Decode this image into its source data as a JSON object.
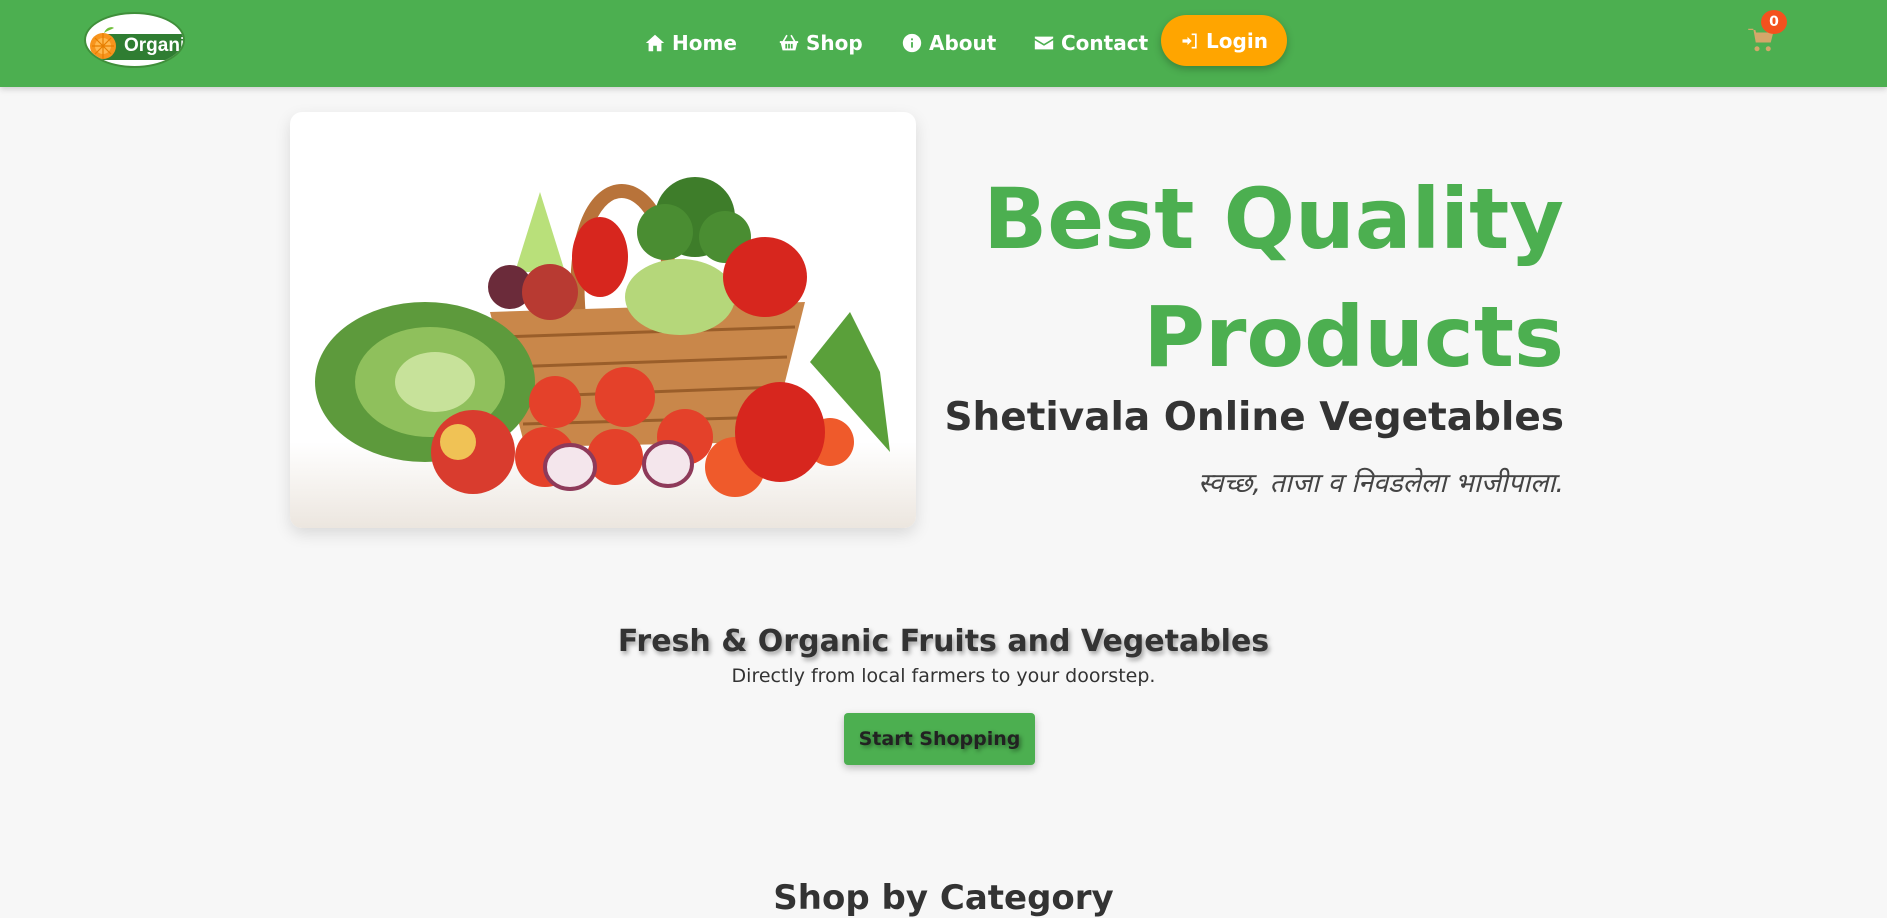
{
  "brand": {
    "logo_text": "Organi"
  },
  "nav": {
    "items": [
      {
        "label": "Home",
        "icon": "home-icon"
      },
      {
        "label": "Shop",
        "icon": "basket-icon"
      },
      {
        "label": "About",
        "icon": "info-icon"
      },
      {
        "label": "Contact",
        "icon": "envelope-icon"
      }
    ],
    "login_label": "Login",
    "cart_count": "0"
  },
  "hero": {
    "image_alt": "Basket of fresh vegetables",
    "title_line1": "Best Quality",
    "title_line2": "Products",
    "subtitle": "Shetivala Online Vegetables",
    "tagline": "स्वच्छ, ताजा व निवडलेला भाजीपाला."
  },
  "promo": {
    "title": "Fresh & Organic Fruits and Vegetables",
    "subtitle": "Directly from local farmers to your doorstep.",
    "cta_label": "Start Shopping"
  },
  "section": {
    "heading": "Shop by Category"
  },
  "colors": {
    "primary": "#4caf50",
    "accent": "#ffa500",
    "badge": "#f4511e",
    "background": "#f7f7f7"
  }
}
